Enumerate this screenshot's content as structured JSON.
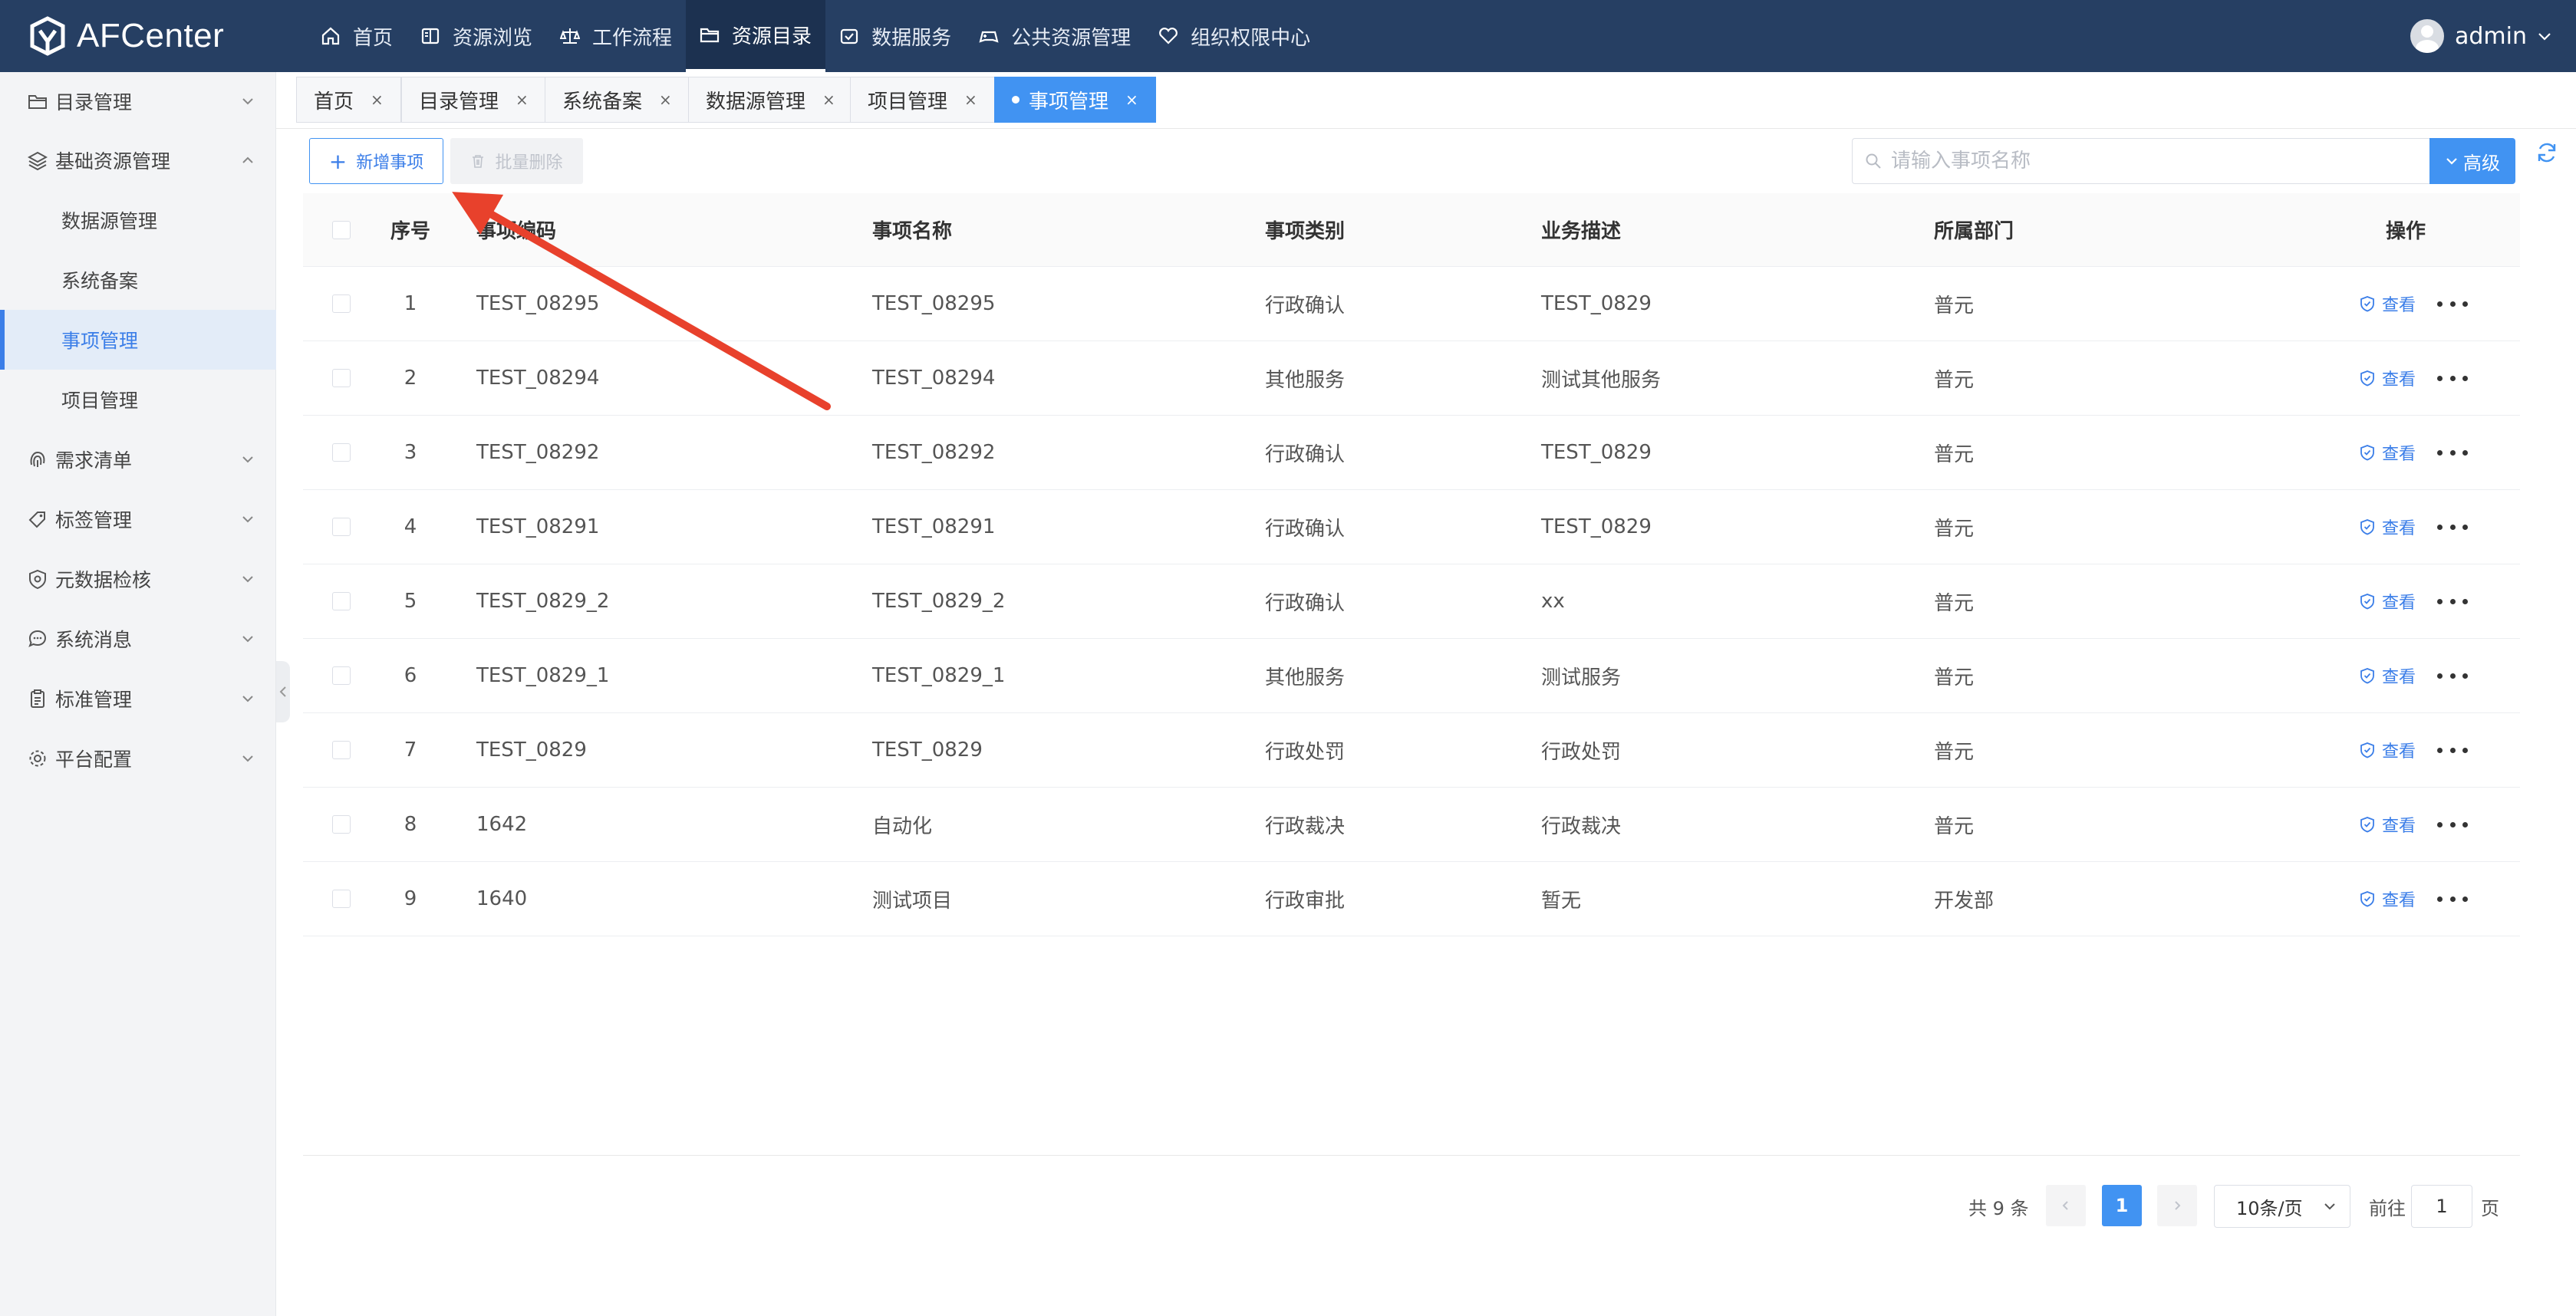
{
  "app": {
    "name": "AFCenter"
  },
  "topnav": [
    {
      "label": "首页",
      "icon": "home-icon"
    },
    {
      "label": "资源浏览",
      "icon": "browse-icon"
    },
    {
      "label": "工作流程",
      "icon": "workflow-icon"
    },
    {
      "label": "资源目录",
      "icon": "folder-icon",
      "active": true
    },
    {
      "label": "数据服务",
      "icon": "data-service-icon"
    },
    {
      "label": "公共资源管理",
      "icon": "gamepad-icon"
    },
    {
      "label": "组织权限中心",
      "icon": "heart-icon"
    }
  ],
  "user": {
    "name": "admin"
  },
  "sidebar": {
    "items": [
      {
        "label": "目录管理",
        "icon": "folder-icon"
      },
      {
        "label": "基础资源管理",
        "icon": "layers-icon",
        "expanded": true
      },
      {
        "label": "数据源管理"
      },
      {
        "label": "系统备案"
      },
      {
        "label": "事项管理",
        "active": true
      },
      {
        "label": "项目管理"
      },
      {
        "label": "需求清单",
        "icon": "fingerprint-icon"
      },
      {
        "label": "标签管理",
        "icon": "tag-icon"
      },
      {
        "label": "元数据检核",
        "icon": "shield-icon"
      },
      {
        "label": "系统消息",
        "icon": "chat-icon"
      },
      {
        "label": "标准管理",
        "icon": "clipboard-icon"
      },
      {
        "label": "平台配置",
        "icon": "gear-icon"
      }
    ]
  },
  "tabs": [
    {
      "label": "首页"
    },
    {
      "label": "目录管理"
    },
    {
      "label": "系统备案"
    },
    {
      "label": "数据源管理"
    },
    {
      "label": "项目管理"
    },
    {
      "label": "事项管理",
      "active": true
    }
  ],
  "tab_close_glyph": "×",
  "toolbar": {
    "add_label": "新增事项",
    "add_plus": "+",
    "batch_delete_label": "批量删除",
    "search_placeholder": "请输入事项名称",
    "search_value": "",
    "advanced_label": "高级"
  },
  "table": {
    "columns": [
      "序号",
      "事项编码",
      "事项名称",
      "事项类别",
      "业务描述",
      "所属部门",
      "操作"
    ],
    "view_label": "查看",
    "rows": [
      {
        "no": "1",
        "code": "TEST_08295",
        "name": "TEST_08295",
        "type": "行政确认",
        "desc": "TEST_0829",
        "dept": "普元"
      },
      {
        "no": "2",
        "code": "TEST_08294",
        "name": "TEST_08294",
        "type": "其他服务",
        "desc": "测试其他服务",
        "dept": "普元"
      },
      {
        "no": "3",
        "code": "TEST_08292",
        "name": "TEST_08292",
        "type": "行政确认",
        "desc": "TEST_0829",
        "dept": "普元"
      },
      {
        "no": "4",
        "code": "TEST_08291",
        "name": "TEST_08291",
        "type": "行政确认",
        "desc": "TEST_0829",
        "dept": "普元"
      },
      {
        "no": "5",
        "code": "TEST_0829_2",
        "name": "TEST_0829_2",
        "type": "行政确认",
        "desc": "xx",
        "dept": "普元"
      },
      {
        "no": "6",
        "code": "TEST_0829_1",
        "name": "TEST_0829_1",
        "type": "其他服务",
        "desc": "测试服务",
        "dept": "普元"
      },
      {
        "no": "7",
        "code": "TEST_0829",
        "name": "TEST_0829",
        "type": "行政处罚",
        "desc": "行政处罚",
        "dept": "普元"
      },
      {
        "no": "8",
        "code": "1642",
        "name": "自动化",
        "type": "行政裁决",
        "desc": "行政裁决",
        "dept": "普元"
      },
      {
        "no": "9",
        "code": "1640",
        "name": "测试项目",
        "type": "行政审批",
        "desc": "暂无",
        "dept": "开发部"
      }
    ]
  },
  "pagination": {
    "total_text": "共 9 条",
    "current_page": "1",
    "page_size": "10条/页",
    "goto_prefix": "前往",
    "goto_value": "1",
    "goto_suffix": "页"
  },
  "colors": {
    "topbar": "#263f63",
    "accent": "#4193f2",
    "annotation_arrow": "#e8412c"
  }
}
